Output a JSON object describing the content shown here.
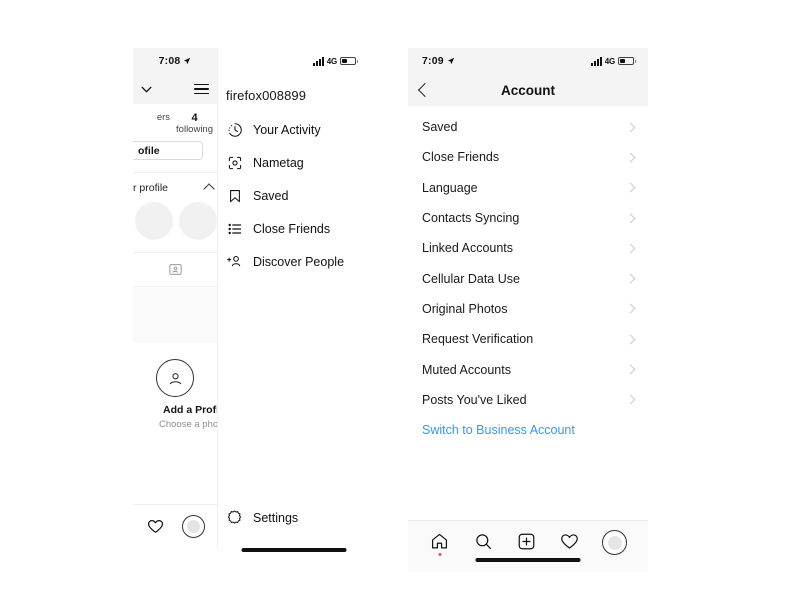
{
  "left_panel": {
    "status_bar": {
      "time": "7:08",
      "location_icon": "location-arrow-icon"
    },
    "nav": {
      "chevron": "chevron-down-icon",
      "menu_icon": "hamburger-menu-icon"
    },
    "stats": [
      {
        "value": "",
        "label": "ers"
      },
      {
        "value": "4",
        "label": "following"
      }
    ],
    "edit_profile_button": "ofile",
    "archive_row": {
      "label": "r profile",
      "chevron": "chevron-up-icon"
    },
    "grid_tab_icon": "profile-card-icon",
    "add_profile": {
      "icon": "person-circle-icon",
      "title": "Add a Profile P",
      "subtitle": "Choose a phot"
    },
    "bottom_nav": [
      {
        "icon": "heart-icon",
        "name": "activity-tab"
      },
      {
        "icon": "avatar-icon",
        "name": "profile-tab"
      }
    ]
  },
  "mid_panel": {
    "status_bar": {
      "network": "4G",
      "signal_icon": "signal-bars-icon",
      "battery_icon": "battery-icon"
    },
    "username": "firefox008899",
    "menu_items": [
      {
        "icon": "clock-activity-icon",
        "label": "Your Activity"
      },
      {
        "icon": "nametag-icon",
        "label": "Nametag"
      },
      {
        "icon": "bookmark-icon",
        "label": "Saved"
      },
      {
        "icon": "close-friends-list-icon",
        "label": "Close Friends"
      },
      {
        "icon": "discover-people-icon",
        "label": "Discover People"
      }
    ],
    "settings": {
      "icon": "gear-icon",
      "label": "Settings"
    }
  },
  "right_panel": {
    "status_bar": {
      "time": "7:09",
      "location_icon": "location-arrow-icon",
      "network": "4G"
    },
    "header": {
      "back_icon": "back-chevron-icon",
      "title": "Account"
    },
    "rows": [
      {
        "label": "Saved",
        "chevron": "chevron-right-icon"
      },
      {
        "label": "Close Friends",
        "chevron": "chevron-right-icon"
      },
      {
        "label": "Language",
        "chevron": "chevron-right-icon"
      },
      {
        "label": "Contacts Syncing",
        "chevron": "chevron-right-icon"
      },
      {
        "label": "Linked Accounts",
        "chevron": "chevron-right-icon"
      },
      {
        "label": "Cellular Data Use",
        "chevron": "chevron-right-icon"
      },
      {
        "label": "Original Photos",
        "chevron": "chevron-right-icon"
      },
      {
        "label": "Request Verification",
        "chevron": "chevron-right-icon"
      },
      {
        "label": "Muted Accounts",
        "chevron": "chevron-right-icon"
      },
      {
        "label": "Posts You've Liked",
        "chevron": "chevron-right-icon"
      }
    ],
    "switch_link": {
      "label": "Switch to Business Account",
      "color": "#3897f0"
    },
    "bottom_nav": [
      {
        "icon": "home-icon",
        "name": "home-tab",
        "badge": true
      },
      {
        "icon": "search-icon",
        "name": "search-tab",
        "badge": false
      },
      {
        "icon": "add-post-icon",
        "name": "add-post-tab",
        "badge": false
      },
      {
        "icon": "heart-icon",
        "name": "activity-tab",
        "badge": false
      },
      {
        "icon": "avatar-icon",
        "name": "profile-tab",
        "badge": false
      }
    ]
  },
  "theme": {
    "accent": "#3897f0",
    "text": "#262626",
    "muted": "#8e8e8e",
    "divider": "#efefef",
    "statusbar_bg": "#f4f4f4",
    "badge": "#ed4956"
  }
}
